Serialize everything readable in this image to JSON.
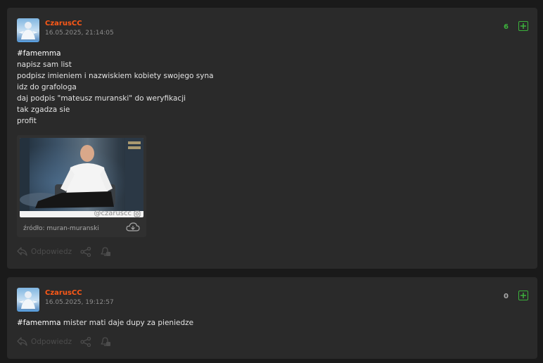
{
  "entries": [
    {
      "author": "CzarusCC",
      "date": "16.05.2025, 21:14:05",
      "votes": "6",
      "vote_color": "#3cb23c",
      "tag": "#famemma",
      "text": "\nnapisz sam list\npodpisz imieniem i nazwiskiem kobiety swojego syna\nidz do grafologa\ndaj podpis \"mateusz muranski\" do weryfikacji\ntak zgadza sie\nprofit",
      "media": {
        "watermark": "@czaruscc",
        "corner_logo": "CLOUT MMA",
        "source": "źródło: muran-muranski"
      },
      "reply_label": "Odpowiedz"
    },
    {
      "author": "CzarusCC",
      "date": "16.05.2025, 19:12:57",
      "votes": "0",
      "vote_color": "#aaaaaa",
      "tag": "#famemma",
      "text": " mister mati daje dupy za pieniedze",
      "reply_label": "Odpowiedz"
    }
  ],
  "icons": [
    "avatar",
    "plus-icon",
    "download-icon",
    "reply-icon",
    "share-icon",
    "notification-bell-icon"
  ],
  "colors": {
    "author": "#ff5917",
    "accent_green": "#3cb23c",
    "card_bg": "#2a2a2a",
    "page_bg": "#1a1a1a"
  }
}
